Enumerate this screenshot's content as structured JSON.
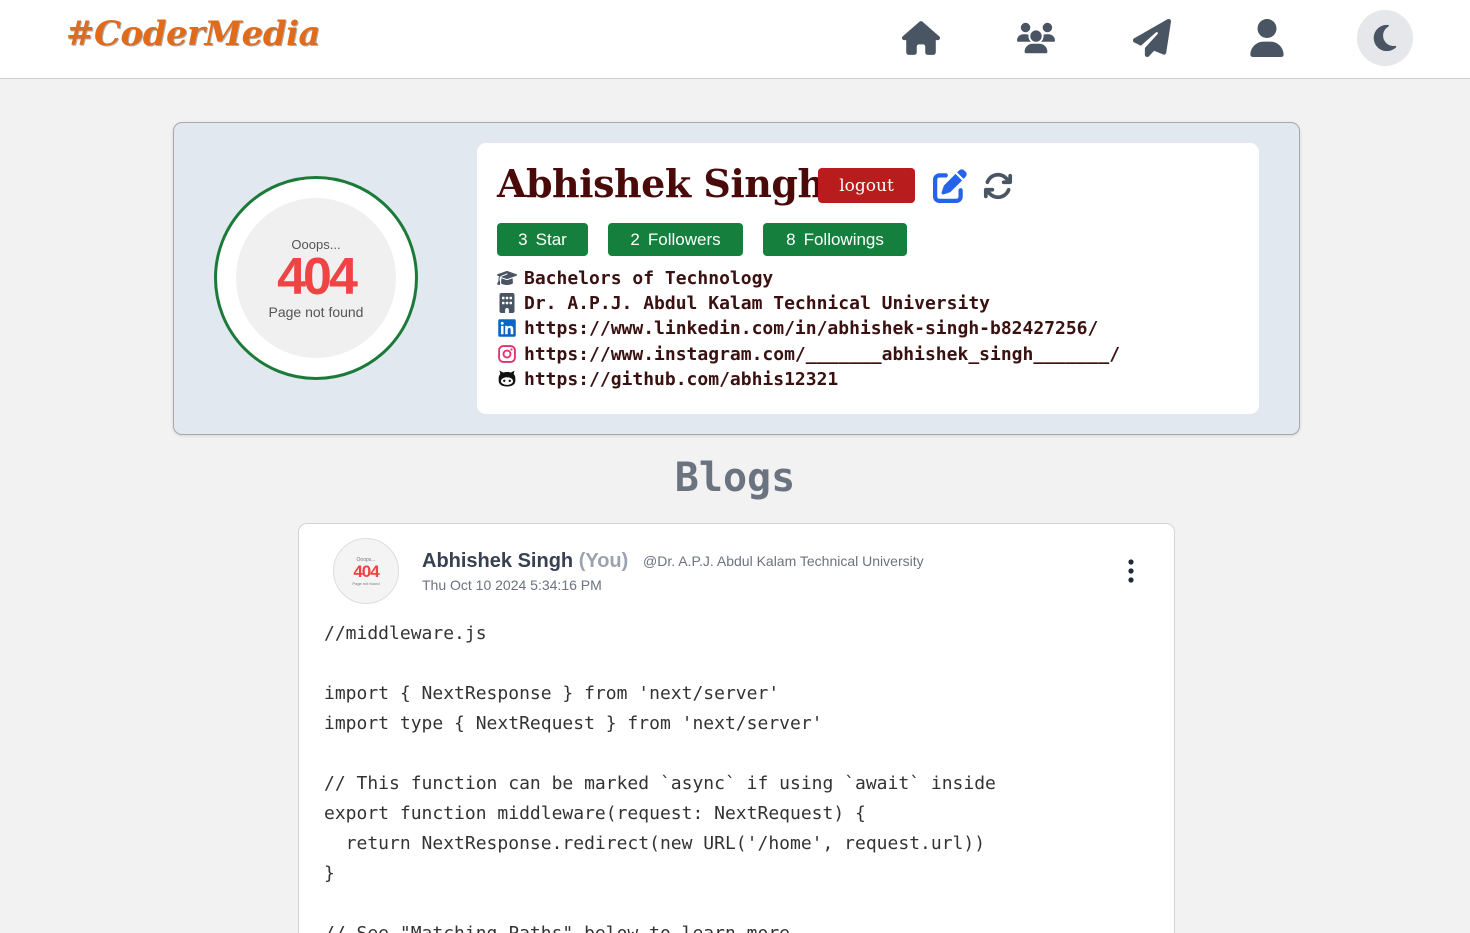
{
  "brand": {
    "name": "#CoderMedia"
  },
  "nav": {
    "icons": [
      "home-icon",
      "users-icon",
      "paper-plane-icon",
      "user-icon"
    ],
    "theme_icon": "moon-icon"
  },
  "profile": {
    "avatar": {
      "oops": "Ooops...",
      "code": "404",
      "text": "Page not found"
    },
    "name": "Abhishek Singh",
    "logout_label": "logout",
    "stats": [
      {
        "count": "3",
        "label": "Star"
      },
      {
        "count": "2",
        "label": "Followers"
      },
      {
        "count": "8",
        "label": "Followings"
      }
    ],
    "details": {
      "degree": "Bachelors of Technology",
      "university": "Dr. A.P.J. Abdul Kalam Technical University",
      "linkedin": "https://www.linkedin.com/in/abhishek-singh-b82427256/",
      "instagram": "https://www.instagram.com/_______abhishek_singh_______/",
      "github": "https://github.com/abhis12321"
    },
    "colors": {
      "stat_green": "#15803d",
      "logout_red": "#b91c1c",
      "edit_blue": "#2563eb",
      "linkedin_blue": "#0a66c2",
      "instagram_pink": "#e1306c"
    }
  },
  "blogs": {
    "title": "Blogs",
    "posts": [
      {
        "avatar": {
          "oops": "Ooops...",
          "code": "404",
          "text": "Page not found"
        },
        "author": "Abhishek Singh",
        "you_tag": "(You)",
        "university": "@Dr. A.P.J. Abdul Kalam Technical University",
        "date": "Thu Oct 10 2024 5:34:16 PM",
        "content": "//middleware.js\n\nimport { NextResponse } from 'next/server'\nimport type { NextRequest } from 'next/server'\n\n// This function can be marked `async` if using `await` inside\nexport function middleware(request: NextRequest) {\n  return NextResponse.redirect(new URL('/home', request.url))\n}\n\n// See \"Matching Paths\" below to learn more"
      }
    ]
  }
}
